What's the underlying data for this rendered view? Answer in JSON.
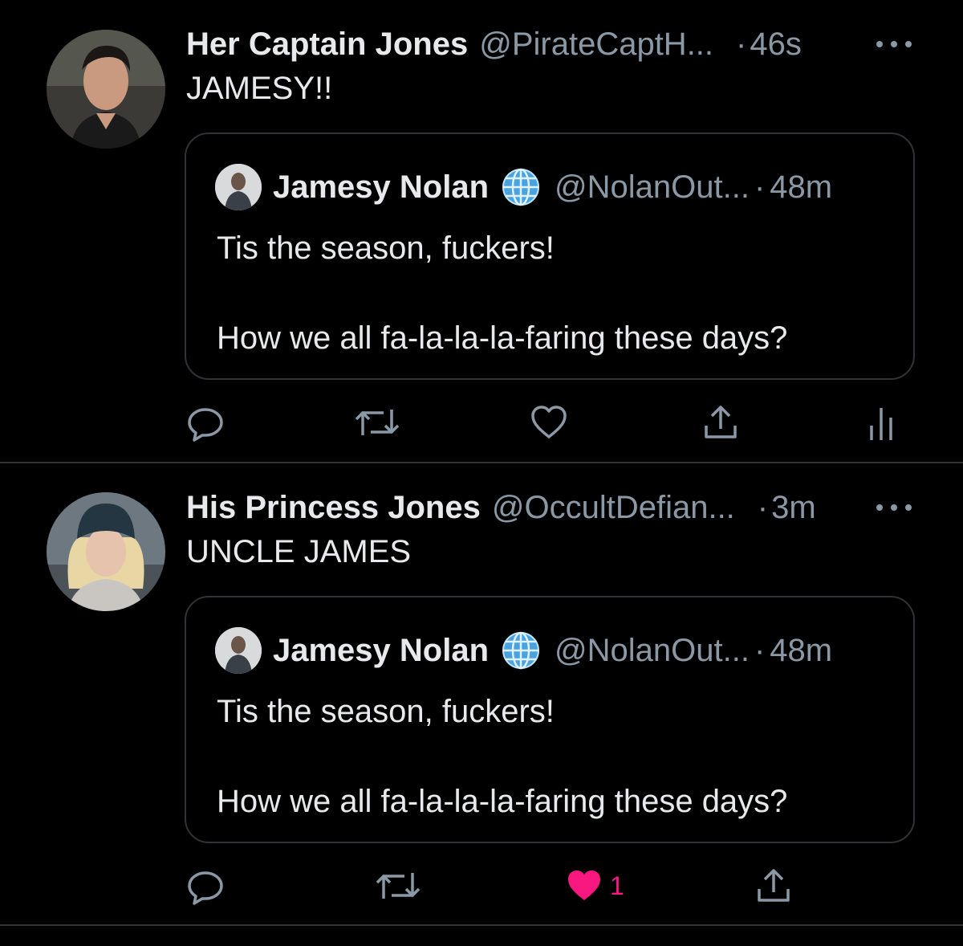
{
  "colors": {
    "background": "#000000",
    "text_primary": "#e7e9ea",
    "text_secondary": "#8b98a5",
    "divider": "#2f3336",
    "like_active": "#f91880"
  },
  "tweets": [
    {
      "display_name": "Her Captain Jones",
      "handle": "@PirateCaptH...",
      "dot": "·",
      "time": "46s",
      "text": "JAMESY!!",
      "avatar_icon": "avatar-man-dark-hair",
      "quote": {
        "display_name": "Jamesy Nolan",
        "badge_icon": "globe-icon",
        "handle": "@NolanOut...",
        "dot": "·",
        "time": "48m",
        "line1": "Tis the season, fuckers!",
        "line2": "How we all fa-la-la-la-faring these days?"
      },
      "actions": {
        "reply_icon": "reply-icon",
        "retweet_icon": "retweet-icon",
        "like_icon": "heart-outline-icon",
        "share_icon": "share-icon",
        "analytics_icon": "analytics-icon"
      }
    },
    {
      "display_name": "His Princess Jones",
      "handle": "@OccultDefian...",
      "dot": "·",
      "time": "3m",
      "text": "UNCLE JAMES",
      "avatar_icon": "avatar-woman-beanie",
      "quote": {
        "display_name": "Jamesy Nolan",
        "badge_icon": "globe-icon",
        "handle": "@NolanOut...",
        "dot": "·",
        "time": "48m",
        "line1": "Tis the season, fuckers!",
        "line2": "How we all fa-la-la-la-faring these days?"
      },
      "actions": {
        "reply_icon": "reply-icon",
        "retweet_icon": "retweet-icon",
        "like_icon": "heart-filled-icon",
        "like_count": "1",
        "share_icon": "share-icon"
      }
    }
  ]
}
